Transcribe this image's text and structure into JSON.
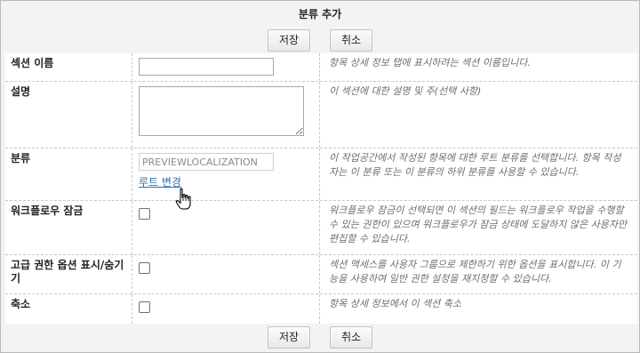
{
  "dialog": {
    "title": "분류 추가",
    "save_label": "저장",
    "cancel_label": "취소"
  },
  "fields": {
    "section_name": {
      "label": "섹션 이름",
      "value": "",
      "help": "항목 상세 정보 탭에 표시하려는 섹션 이름입니다."
    },
    "description": {
      "label": "설명",
      "value": "",
      "help": "이 섹션에 대한 설명 및 주(선택 사항)"
    },
    "category": {
      "label": "분류",
      "value": "PREVIEWLOCALIZATION",
      "link": "루트 변경",
      "help": "이 작업공간에서 작성된 항목에 대한 루트 분류를 선택합니다. 항목 작성자는 이 분류 또는 이 분류의 하위 분류를 사용할 수 있습니다."
    },
    "workflow_lock": {
      "label": "워크플로우 잠금",
      "checked": false,
      "help": "워크플로우 잠금이 선택되면 이 섹션의 필드는 워크플로우 작업을 수행할 수 있는 권한이 있으며 워크플로우가 잠금 상태에 도달하지 않은 사용자만 편집할 수 있습니다."
    },
    "advanced_permissions": {
      "label": "고급 권한 옵션 표시/숨기기",
      "checked": false,
      "help": "섹션 액세스를 사용자 그룹으로 제한하기 위한 옵션을 표시합니다. 이 기능을 사용하여 일반 권한 설정을 재지정할 수 있습니다."
    },
    "collapse": {
      "label": "축소",
      "checked": false,
      "help": "항목 상세 정보에서 이 섹션 축소"
    }
  }
}
